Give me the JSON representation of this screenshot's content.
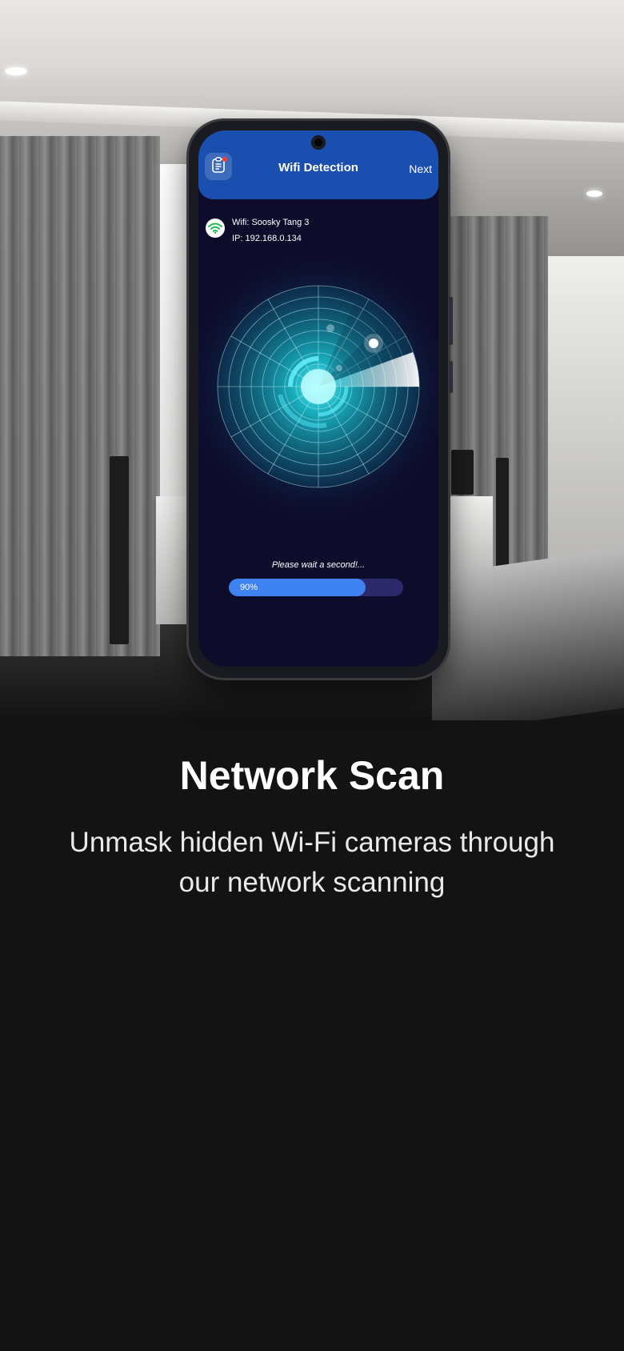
{
  "app": {
    "title": "Wifi Detection",
    "next_label": "Next"
  },
  "wifi": {
    "name_line": "Wifi: Soosky Tang 3",
    "ip_line": "IP: 192.168.0.134"
  },
  "scan": {
    "wait_text": "Please wait a second!...",
    "progress": 0.9,
    "progress_label": "90%"
  },
  "promo": {
    "headline": "Network Scan",
    "subtext_line1": "Unmask hidden Wi-Fi cameras through",
    "subtext_line2": "our network scanning"
  },
  "colors": {
    "header_blue": "#1a4fb0",
    "progress_blue": "#3f82f2",
    "screen_bg": "#0e0c2b",
    "radar_cyan": "#19e3e3"
  },
  "icons": {
    "history": "clipboard-list-icon",
    "wifi": "wifi-icon",
    "radar": "radar-icon"
  }
}
